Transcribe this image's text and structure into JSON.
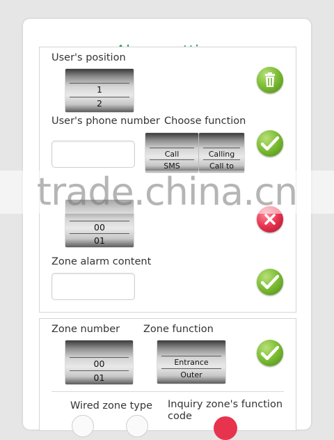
{
  "header": {
    "title": "Alarm setting"
  },
  "user_section": {
    "position_label": "User's position",
    "position_picker": [
      "1",
      "2"
    ],
    "phone_label": "User's phone number",
    "phone_value": "",
    "function_label": "Choose function",
    "function_picker_left": [
      "Call",
      "SMS"
    ],
    "function_picker_right": [
      "Calling",
      "Call to"
    ]
  },
  "zone_content_section": {
    "picker": [
      "00",
      "01"
    ],
    "content_label": "Zone alarm content",
    "content_value": ""
  },
  "zone_section": {
    "number_label": "Zone number",
    "number_picker": [
      "00",
      "01"
    ],
    "function_label": "Zone function",
    "function_picker": [
      "Entrance",
      "Outer"
    ],
    "wired_label": "Wired zone type",
    "inquiry_label": "Inquiry zone's function",
    "inquiry_label_cont": "code"
  },
  "icons": {
    "delete": "trash-icon",
    "confirm": "checkmark-icon",
    "cancel": "close-icon"
  },
  "watermark": "trade.china.cn",
  "colors": {
    "title": "#2e9b57",
    "confirm": "#7fbf35",
    "cancel": "#e8334f"
  }
}
